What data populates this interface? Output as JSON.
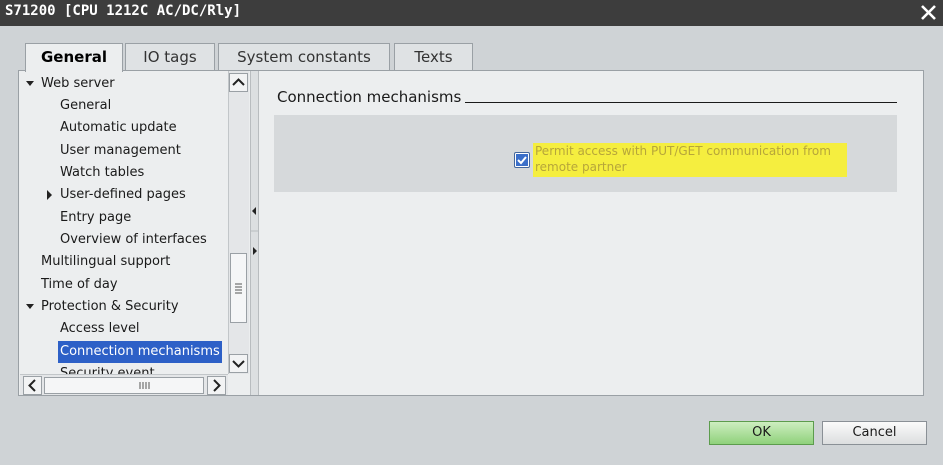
{
  "window": {
    "title": "S71200 [CPU 1212C AC/DC/Rly]"
  },
  "tabs": [
    {
      "label": "General",
      "active": true
    },
    {
      "label": "IO tags",
      "active": false
    },
    {
      "label": "System constants",
      "active": false
    },
    {
      "label": "Texts",
      "active": false
    }
  ],
  "tree": {
    "items": [
      {
        "label": "Web server",
        "expanded": true
      },
      {
        "label": "General"
      },
      {
        "label": "Automatic update"
      },
      {
        "label": "User management"
      },
      {
        "label": "Watch tables"
      },
      {
        "label": "User-defined pages",
        "expanded": false
      },
      {
        "label": "Entry page"
      },
      {
        "label": "Overview of interfaces"
      },
      {
        "label": "Multilingual support"
      },
      {
        "label": "Time of day"
      },
      {
        "label": "Protection & Security",
        "expanded": true
      },
      {
        "label": "Access level"
      },
      {
        "label": "Connection mechanisms",
        "selected": true
      },
      {
        "label": "Security event"
      }
    ]
  },
  "content": {
    "section_title": "Connection mechanisms",
    "checkbox": {
      "checked": true,
      "label": "Permit access with PUT/GET communication from remote partner"
    }
  },
  "buttons": {
    "ok": "OK",
    "cancel": "Cancel"
  },
  "colors": {
    "selection": "#2d60c7",
    "highlight": "#f5ee3f",
    "ok_button": "#a8e090"
  }
}
